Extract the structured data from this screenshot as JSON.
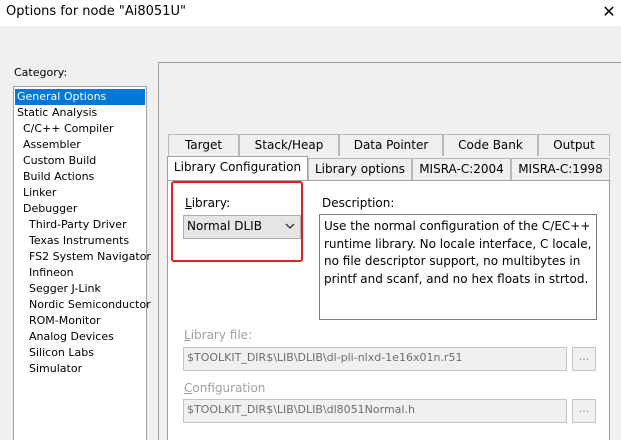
{
  "window": {
    "title": "Options for node \"Ai8051U\"",
    "close_glyph": "✕"
  },
  "category": {
    "label": "Category:",
    "items": [
      {
        "label": "General Options",
        "selected": true
      },
      {
        "label": "Static Analysis"
      },
      {
        "label": "C/C++ Compiler"
      },
      {
        "label": "Assembler"
      },
      {
        "label": "Custom Build"
      },
      {
        "label": "Build Actions"
      },
      {
        "label": "Linker"
      },
      {
        "label": "Debugger"
      },
      {
        "label": "Third-Party Driver"
      },
      {
        "label": "Texas Instruments"
      },
      {
        "label": "FS2 System Navigator"
      },
      {
        "label": "Infineon"
      },
      {
        "label": "Segger J-Link"
      },
      {
        "label": "Nordic Semiconductor"
      },
      {
        "label": "ROM-Monitor"
      },
      {
        "label": "Analog Devices"
      },
      {
        "label": "Silicon Labs"
      },
      {
        "label": "Simulator"
      }
    ]
  },
  "tabs": {
    "row1": [
      "Target",
      "Stack/Heap",
      "Data Pointer",
      "Code Bank",
      "Output"
    ],
    "row2": [
      "Library Configuration",
      "Library options",
      "MISRA-C:2004",
      "MISRA-C:1998"
    ],
    "active": "Library Configuration"
  },
  "library": {
    "label_first": "L",
    "label_rest": "ibrary:",
    "value": "Normal DLIB",
    "highlight_color": "#e02020"
  },
  "description": {
    "label": "Description:",
    "text": "Use the normal configuration of the C/EC++ runtime library. No locale interface, C locale, no file descriptor support, no multibytes in printf and scanf, and no hex floats in strtod."
  },
  "library_file": {
    "label_first": "L",
    "label_rest": "ibrary file:",
    "value": "$TOOLKIT_DIR$\\LIB\\DLIB\\dl-pli-nlxd-1e16x01n.r51",
    "browse_label": "..."
  },
  "configuration": {
    "label_first": "C",
    "label_rest": "onfiguration",
    "value": "$TOOLKIT_DIR$\\LIB\\DLIB\\dl8051Normal.h",
    "browse_label": "..."
  },
  "colors": {
    "selection": "#0078d7",
    "accent_box": "#e02020"
  }
}
